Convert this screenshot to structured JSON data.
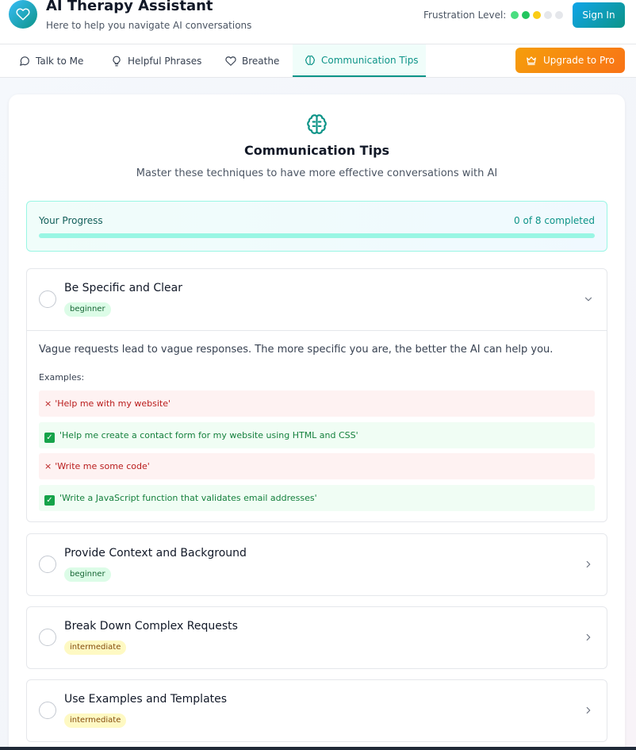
{
  "header": {
    "title": "AI Therapy Assistant",
    "subtitle": "Here to help you navigate AI conversations",
    "frustration_label": "Frustration Level:",
    "frustration_level": 3,
    "frustration_max": 5,
    "sign_in": "Sign In"
  },
  "colors": {
    "accent": "#0d9488",
    "frustration_levels": [
      "#4ade80",
      "#22c55e",
      "#facc15",
      "#e5e7eb",
      "#e5e7eb"
    ]
  },
  "nav": {
    "tabs": [
      {
        "label": "Talk to Me",
        "icon": "chat-icon"
      },
      {
        "label": "Helpful Phrases",
        "icon": "lightbulb-icon"
      },
      {
        "label": "Breathe",
        "icon": "heart-icon"
      },
      {
        "label": "Communication Tips",
        "icon": "brain-icon",
        "active": true
      }
    ],
    "upgrade": "Upgrade to Pro"
  },
  "main": {
    "title": "Communication Tips",
    "subtitle": "Master these techniques to have more effective conversations with AI",
    "progress": {
      "label": "Your Progress",
      "count": "0 of 8 completed",
      "completed": 0,
      "total": 8
    },
    "tips": [
      {
        "title": "Be Specific and Clear",
        "level": "beginner",
        "expanded": true,
        "description": "Vague requests lead to vague responses. The more specific you are, the better the AI can help you.",
        "examples_label": "Examples:",
        "examples": [
          {
            "type": "bad",
            "mark": "×",
            "text": "'Help me with my website'"
          },
          {
            "type": "good",
            "mark": "✓",
            "text": "'Help me create a contact form for my website using HTML and CSS'"
          },
          {
            "type": "bad",
            "mark": "×",
            "text": "'Write me some code'"
          },
          {
            "type": "good",
            "mark": "✓",
            "text": "'Write a JavaScript function that validates email addresses'"
          }
        ]
      },
      {
        "title": "Provide Context and Background",
        "level": "beginner",
        "expanded": false
      },
      {
        "title": "Break Down Complex Requests",
        "level": "intermediate",
        "expanded": false
      },
      {
        "title": "Use Examples and Templates",
        "level": "intermediate",
        "expanded": false
      }
    ]
  }
}
